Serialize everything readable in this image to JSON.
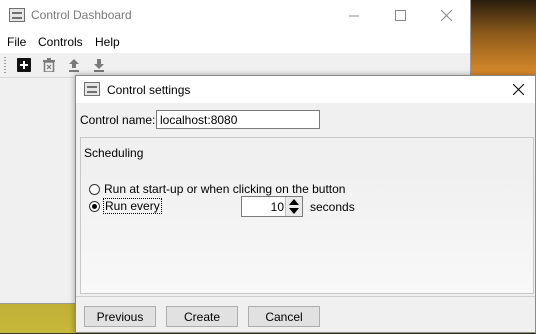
{
  "main_window": {
    "title": "Control Dashboard",
    "menu": [
      "File",
      "Controls",
      "Help"
    ],
    "toolbar": [
      "add-icon",
      "delete-icon",
      "move-up-icon",
      "move-down-icon"
    ]
  },
  "dialog": {
    "title": "Control settings",
    "control_name_label": "Control name:",
    "control_name_value": "localhost:8080",
    "scheduling_label": "Scheduling",
    "radio_startup_label": "Run at start-up or when clicking on the button",
    "radio_every_label": "Run every",
    "every_value": "10",
    "every_unit": "seconds",
    "selected_option": "Run every",
    "buttons": {
      "previous": "Previous",
      "create": "Create",
      "cancel": "Cancel"
    }
  },
  "colors": {
    "window_bg": "#f0f0f0",
    "titlebar_bg": "#ffffff",
    "button_bg": "#e1e1e1"
  }
}
